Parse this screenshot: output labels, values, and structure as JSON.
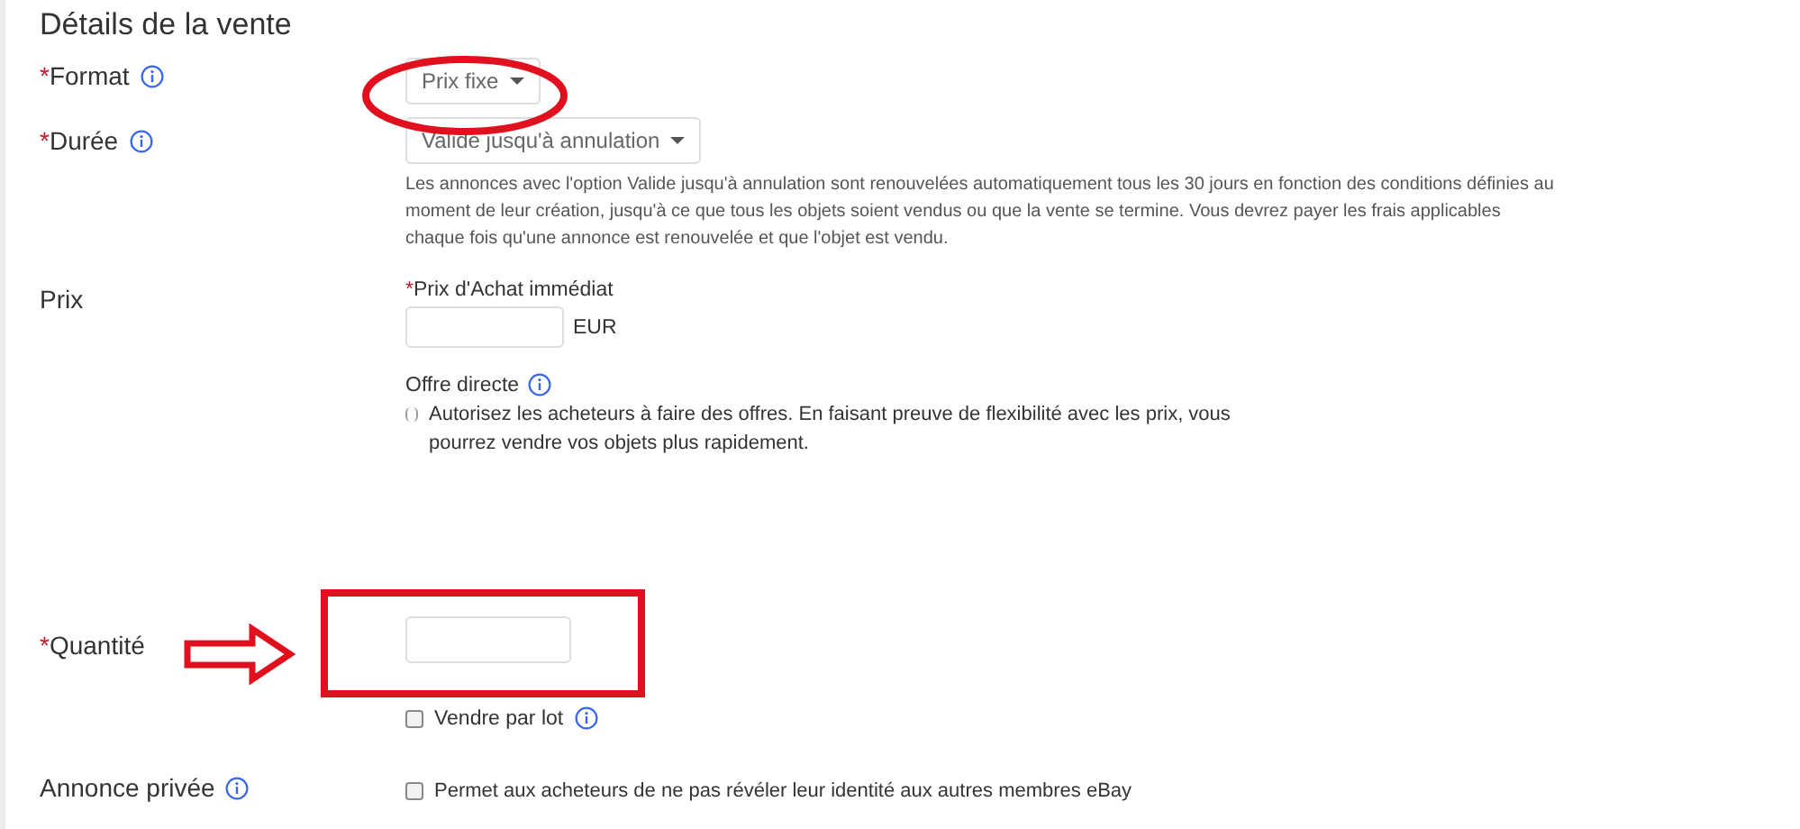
{
  "section_title": "Détails de la vente",
  "fields": [
    {
      "kind": "select",
      "label": "Format",
      "required_mark": "*",
      "info": true,
      "value": "Prix fixe"
    },
    {
      "kind": "select",
      "label": "Durée",
      "required_mark": "*",
      "info": true,
      "value": "Valide jusqu'à annulation",
      "help": "Les annonces avec l'option Valide jusqu'à annulation sont renouvelées automatiquement tous les 30 jours en fonction des conditions définies au moment de leur création, jusqu'à ce que tous les objets soient vendus ou que la vente se termine. Vous devrez payer les frais applicables chaque fois qu'une annonce est renouvelée et que l'objet est vendu."
    },
    {
      "kind": "price",
      "label": "Prix",
      "info": false,
      "price_label": "Prix d'Achat immédiat",
      "price_required_mark": "*",
      "currency": "EUR",
      "offer_label": "Offre directe",
      "offer_info": true,
      "offer_checked": false,
      "offer_text": "Autorisez les acheteurs à faire des offres. En faisant preuve de flexibilité avec les prix, vous pourrez vendre vos objets plus rapidement."
    },
    {
      "kind": "quantity",
      "label": "Quantité",
      "required_mark": "*",
      "info": false,
      "lot_label": "Vendre par lot",
      "lot_info": true,
      "lot_checked": false
    },
    {
      "kind": "checkbox",
      "label": "Annonce privée",
      "info": true,
      "checked": false,
      "text": "Permet aux acheteurs de ne pas révéler leur identité aux autres membres eBay"
    }
  ]
}
